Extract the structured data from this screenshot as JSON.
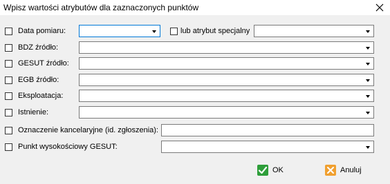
{
  "window": {
    "title": "Wpisz wartości atrybutów dla zaznaczonych punktów"
  },
  "form": {
    "data_pomiaru": {
      "label": "Data pomiaru:",
      "value": ""
    },
    "lub_atrybut": {
      "label": "lub atrybut specjalny",
      "value": ""
    },
    "bdz": {
      "label": "BDZ źródło:",
      "value": ""
    },
    "gesut": {
      "label": "GESUT źródło:",
      "value": ""
    },
    "egb": {
      "label": "EGB źródło:",
      "value": ""
    },
    "eksploatacja": {
      "label": "Eksploatacja:",
      "value": ""
    },
    "istnienie": {
      "label": "Istnienie:",
      "value": ""
    },
    "oznaczenie": {
      "label": "Oznaczenie kancelaryjne (id. zgłoszenia):",
      "value": ""
    },
    "punkt": {
      "label": "Punkt wysokościowy GESUT:",
      "value": ""
    }
  },
  "buttons": {
    "ok_label": "OK",
    "cancel_label": "Anuluj"
  },
  "colors": {
    "ok_icon": "#2e9e3a",
    "cancel_icon": "#f0a030",
    "focus_border": "#0078d7"
  },
  "icons": {
    "close": "close-icon",
    "ok": "check-icon",
    "cancel": "x-icon"
  }
}
